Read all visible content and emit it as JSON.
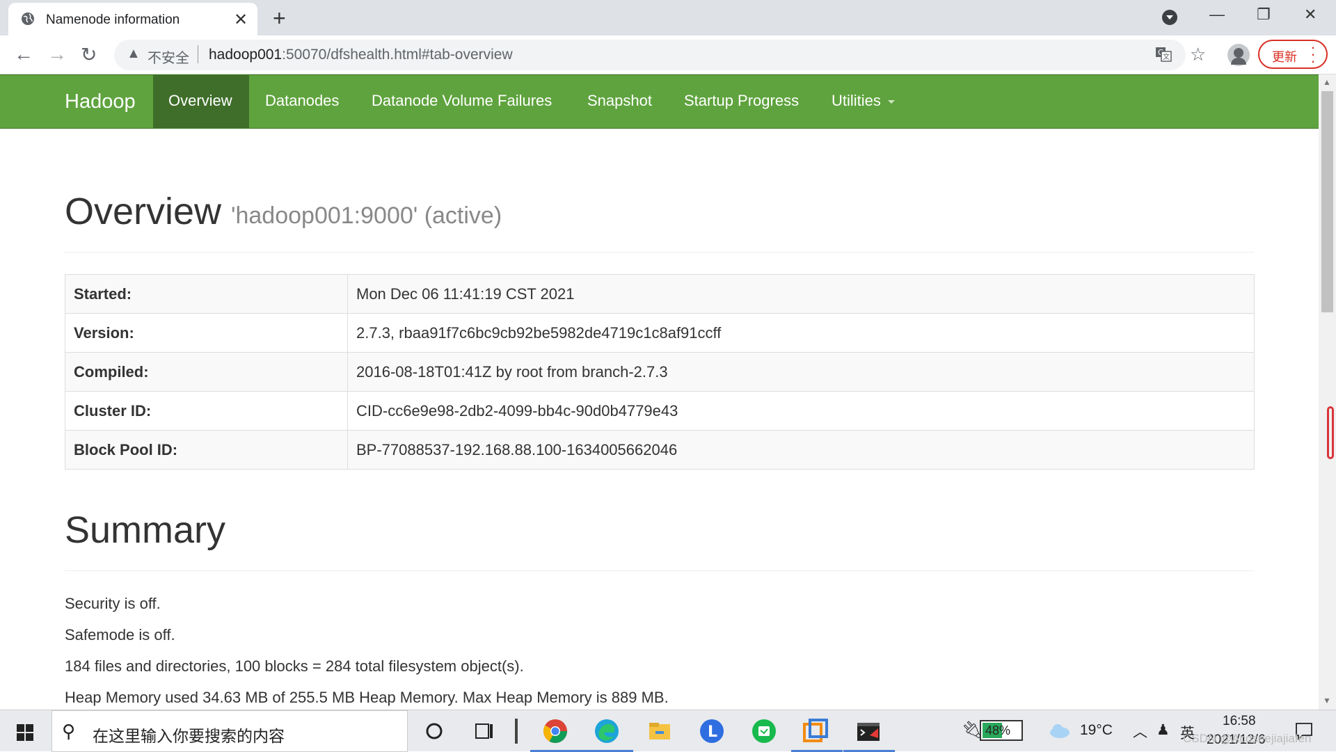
{
  "browser": {
    "tab_title": "Namenode information",
    "new_tab": "+",
    "insecure_label": "不安全",
    "url_host": "hadoop001",
    "url_rest": ":50070/dfshealth.html#tab-overview",
    "update_label": "更新"
  },
  "nav": {
    "brand": "Hadoop",
    "items": [
      "Overview",
      "Datanodes",
      "Datanode Volume Failures",
      "Snapshot",
      "Startup Progress",
      "Utilities"
    ],
    "active": "Overview"
  },
  "overview": {
    "title": "Overview",
    "subtitle": "'hadoop001:9000' (active)",
    "rows": [
      {
        "key": "Started:",
        "value": "Mon Dec 06 11:41:19 CST 2021"
      },
      {
        "key": "Version:",
        "value": "2.7.3, rbaa91f7c6bc9cb92be5982de4719c1c8af91ccff"
      },
      {
        "key": "Compiled:",
        "value": "2016-08-18T01:41Z by root from branch-2.7.3"
      },
      {
        "key": "Cluster ID:",
        "value": "CID-cc6e9e98-2db2-4099-bb4c-90d0b4779e43"
      },
      {
        "key": "Block Pool ID:",
        "value": "BP-77088537-192.168.88.100-1634005662046"
      }
    ]
  },
  "summary": {
    "title": "Summary",
    "lines": [
      "Security is off.",
      "Safemode is off.",
      "184 files and directories, 100 blocks = 284 total filesystem object(s).",
      "Heap Memory used 34.63 MB of 255.5 MB Heap Memory. Max Heap Memory is 889 MB."
    ]
  },
  "taskbar": {
    "search_placeholder": "在这里输入你要搜索的内容",
    "battery": "48%",
    "temperature": "19°C",
    "ime": "英",
    "time": "16:58",
    "date": "2021/12/6",
    "watermark": "CSDN @Acdseejiajiafen"
  },
  "colors": {
    "navbar": "#5fa33e",
    "navbar_active": "#3f6e2a",
    "update_red": "#d93025"
  }
}
